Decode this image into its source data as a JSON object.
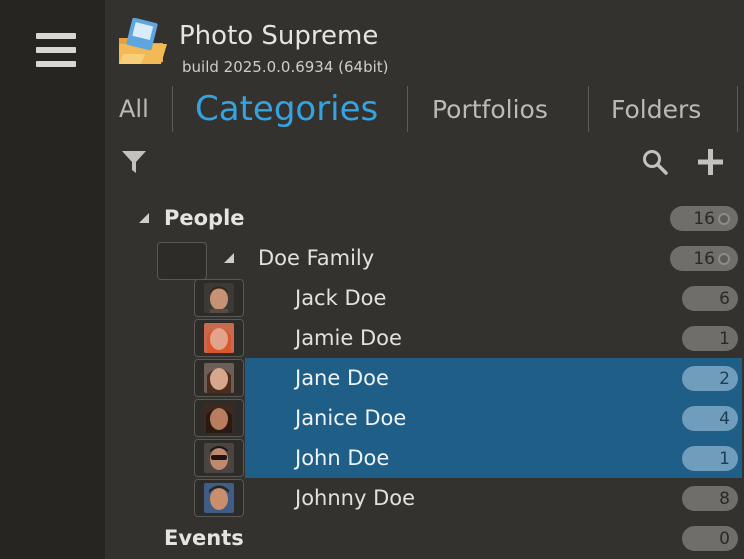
{
  "app": {
    "title": "Photo Supreme",
    "build": "build 2025.0.0.6934 (64bit)"
  },
  "tabs": [
    {
      "label": "All",
      "active": false
    },
    {
      "label": "Categories",
      "active": true
    },
    {
      "label": "Portfolios",
      "active": false
    },
    {
      "label": "Folders",
      "active": false
    }
  ],
  "toolbar": {
    "filter_icon": "filter-icon",
    "search_icon": "search-icon",
    "add_icon": "plus-icon"
  },
  "tree": {
    "people": {
      "label": "People",
      "count": "16",
      "expanded": true
    },
    "doe_family": {
      "label": "Doe Family",
      "count": "16",
      "expanded": true
    },
    "members": [
      {
        "label": "Jack Doe",
        "count": "6",
        "selected": false,
        "skin": "#c69274",
        "hair": "#3a2418"
      },
      {
        "label": "Jamie Doe",
        "count": "1",
        "selected": false,
        "skin": "#e3a38a",
        "hair": "#d9562f"
      },
      {
        "label": "Jane Doe",
        "count": "2",
        "selected": true,
        "skin": "#d7a78c",
        "hair": "#4a2d1f"
      },
      {
        "label": "Janice Doe",
        "count": "4",
        "selected": true,
        "skin": "#b97c5f",
        "hair": "#2b1a12"
      },
      {
        "label": "John Doe",
        "count": "1",
        "selected": true,
        "skin": "#c08a6f",
        "hair": "#1c1714"
      },
      {
        "label": "Johnny Doe",
        "count": "8",
        "selected": false,
        "skin": "#c98e6c",
        "hair": "#3f5d86"
      }
    ],
    "events": {
      "label": "Events",
      "count": "0"
    }
  },
  "colors": {
    "accent": "#35a3e0",
    "selection": "#1f5f87",
    "panel": "#34322f",
    "rail": "#262522"
  }
}
